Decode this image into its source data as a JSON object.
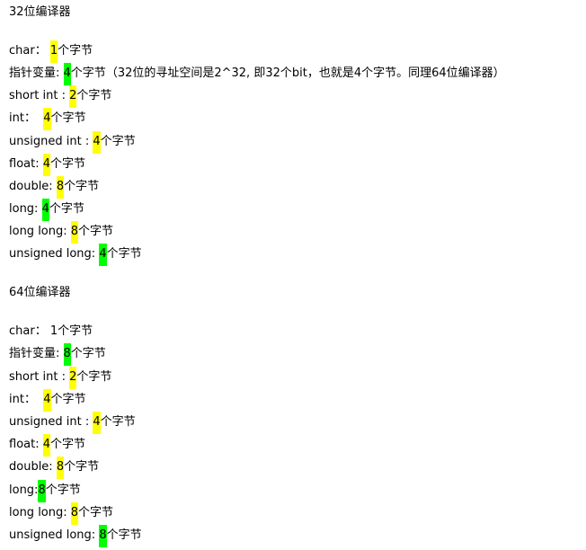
{
  "colors": {
    "yellow": "#ffff00",
    "green": "#00ff00"
  },
  "sections": [
    {
      "title": "32位编译器",
      "rows": [
        {
          "label": "char： ",
          "value": "1",
          "unit": "个字节",
          "highlight": "yellow",
          "note": ""
        },
        {
          "label": "指针变量: ",
          "value": "4",
          "unit": "个字节",
          "highlight": "green",
          "note": "（32位的寻址空间是2^32, 即32个bit，也就是4个字节。同理64位编译器）"
        },
        {
          "label": "short int : ",
          "value": "2",
          "unit": "个字节",
          "highlight": "yellow",
          "note": ""
        },
        {
          "label": "int：  ",
          "value": "4",
          "unit": "个字节",
          "highlight": "yellow",
          "note": ""
        },
        {
          "label": "unsigned int : ",
          "value": "4",
          "unit": "个字节",
          "highlight": "yellow",
          "note": ""
        },
        {
          "label": "float: ",
          "value": "4",
          "unit": "个字节",
          "highlight": "yellow",
          "note": ""
        },
        {
          "label": "double: ",
          "value": "8",
          "unit": "个字节",
          "highlight": "yellow",
          "note": ""
        },
        {
          "label": "long: ",
          "value": "4",
          "unit": "个字节",
          "highlight": "green",
          "note": ""
        },
        {
          "label": "long long: ",
          "value": "8",
          "unit": "个字节",
          "highlight": "yellow",
          "note": ""
        },
        {
          "label": "unsigned long: ",
          "value": "4",
          "unit": "个字节",
          "highlight": "green",
          "note": ""
        }
      ]
    },
    {
      "title": "64位编译器",
      "rows": [
        {
          "label": "char： ",
          "value": "1",
          "unit": "个字节",
          "highlight": "none",
          "note": ""
        },
        {
          "label": "指针变量: ",
          "value": "8",
          "unit": "个字节",
          "highlight": "green",
          "note": ""
        },
        {
          "label": "short int : ",
          "value": "2",
          "unit": "个字节",
          "highlight": "yellow",
          "note": ""
        },
        {
          "label": "int：  ",
          "value": "4",
          "unit": "个字节",
          "highlight": "yellow",
          "note": ""
        },
        {
          "label": "unsigned int : ",
          "value": "4",
          "unit": "个字节",
          "highlight": "yellow",
          "note": ""
        },
        {
          "label": "float: ",
          "value": "4",
          "unit": "个字节",
          "highlight": "yellow",
          "note": ""
        },
        {
          "label": "double: ",
          "value": "8",
          "unit": "个字节",
          "highlight": "yellow",
          "note": ""
        },
        {
          "label": "long:",
          "value": "8",
          "unit": "个字节",
          "highlight": "green",
          "note": ""
        },
        {
          "label": "long long: ",
          "value": "8",
          "unit": "个字节",
          "highlight": "yellow",
          "note": ""
        },
        {
          "label": "unsigned long: ",
          "value": "8",
          "unit": "个字节",
          "highlight": "green",
          "note": ""
        }
      ]
    }
  ]
}
